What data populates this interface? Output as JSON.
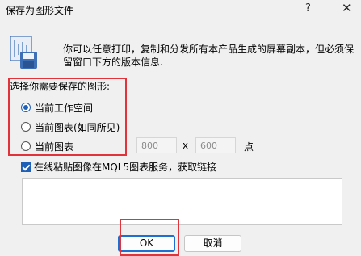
{
  "window": {
    "title": "保存为图形文件",
    "help_glyph": "?",
    "close_glyph": "✕"
  },
  "intro_text": "你可以任意打印，复制和分发所有本产品生成的屏幕副本，但必须保留窗口下方的版本信息.",
  "capture_group": {
    "label": "选择你需要保存的图形:",
    "options": [
      {
        "label": "当前工作空间",
        "checked": true
      },
      {
        "label": "当前图表(如同所见)",
        "checked": false
      },
      {
        "label": "当前图表",
        "checked": false
      }
    ],
    "width_value": "800",
    "separator": "x",
    "height_value": "600",
    "unit": "点"
  },
  "publish": {
    "label": "在线粘贴图像在MQL5图表服务，获取链接",
    "checked": true,
    "link_value": ""
  },
  "buttons": {
    "ok": "OK",
    "cancel": "取消"
  },
  "colors": {
    "accent": "#1e5fb8",
    "highlight": "#e0343a",
    "background": "#f0f0f0"
  }
}
